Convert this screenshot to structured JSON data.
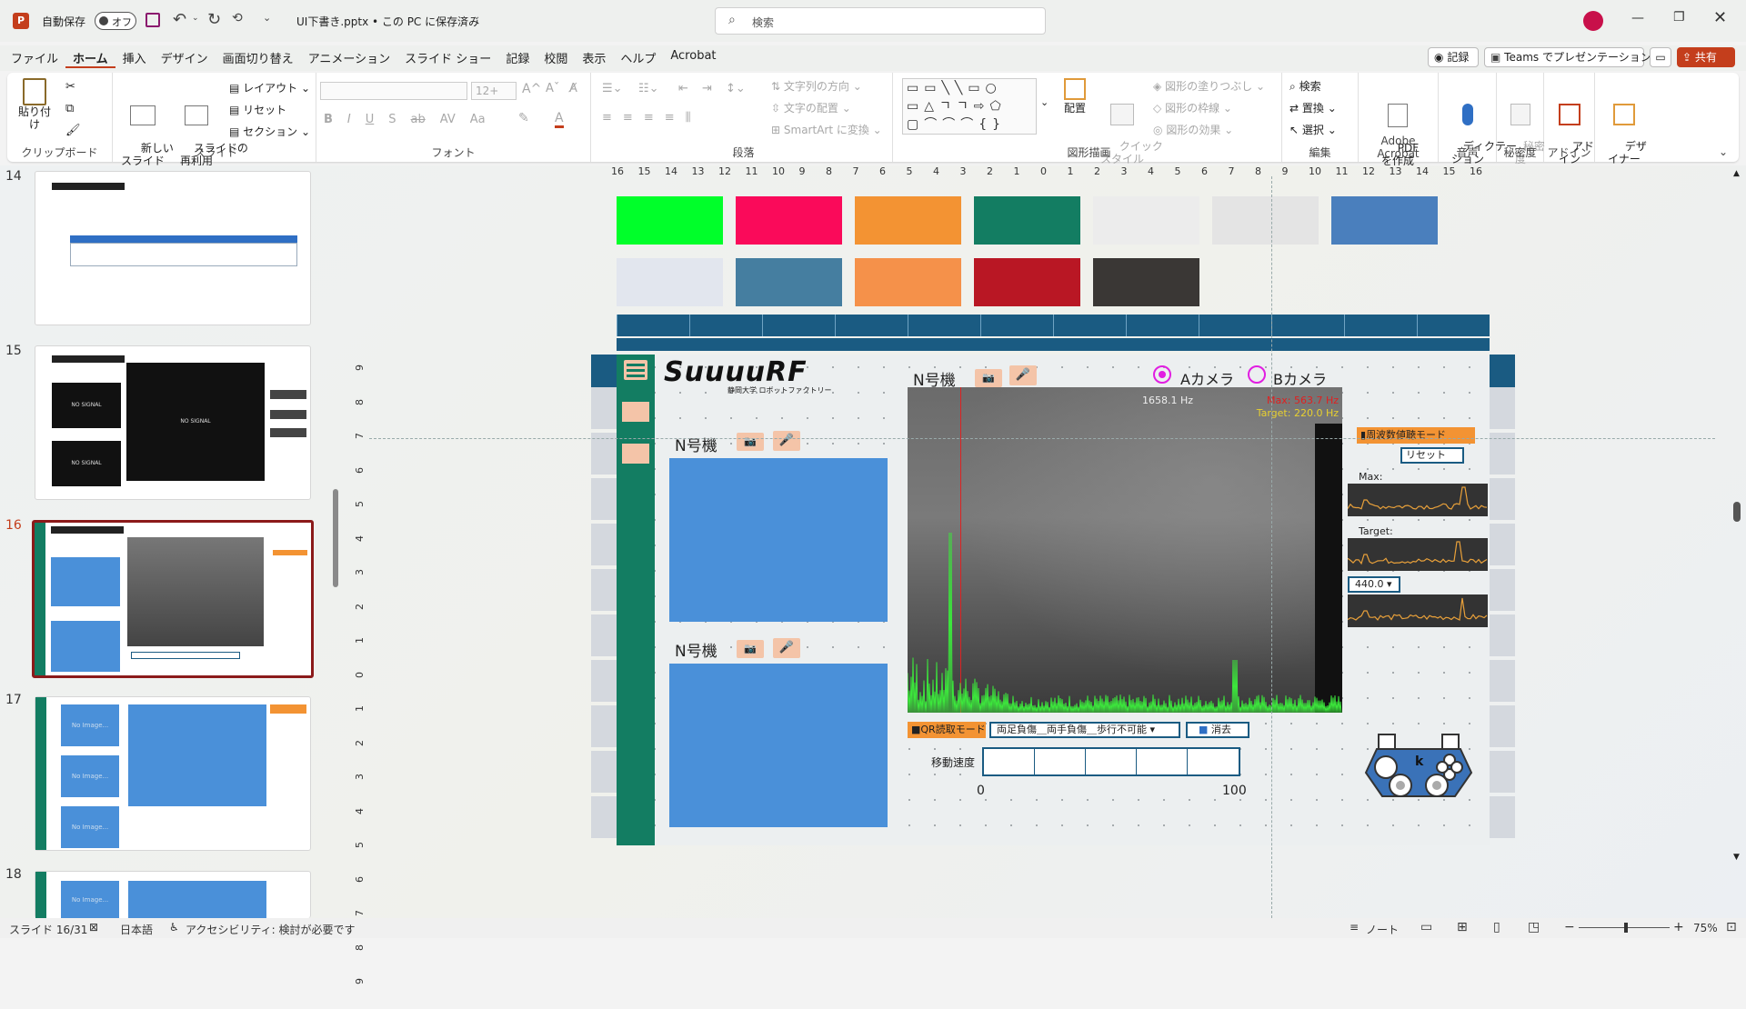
{
  "app": {
    "autosave_label": "自動保存",
    "autosave_state": "オフ",
    "file_title": "UI下書き.pptx • この PC に保存済み",
    "search_placeholder": "検索",
    "accent": "#c43e1c"
  },
  "menu": {
    "tabs": [
      "ファイル",
      "ホーム",
      "挿入",
      "デザイン",
      "画面切り替え",
      "アニメーション",
      "スライド ショー",
      "記録",
      "校閲",
      "表示",
      "ヘルプ",
      "Acrobat"
    ],
    "active": "ホーム",
    "record_label": "記録",
    "teams_label": "Teams でプレゼンテーション",
    "share_label": "共有"
  },
  "ribbon": {
    "clipboard": {
      "paste": "貼り付け",
      "label": "クリップボード"
    },
    "slides": {
      "new_slide": "新しい\nスライド",
      "reuse": "スライドの\n再利用",
      "layout": "レイアウト",
      "reset": "リセット",
      "section": "セクション",
      "label": "スライド"
    },
    "font": {
      "size": "12+",
      "label": "フォント",
      "buttons": [
        "B",
        "I",
        "U",
        "S",
        "ab",
        "AV",
        "Aa"
      ]
    },
    "paragraph": {
      "text_direction": "文字列の方向",
      "text_align": "文字の配置",
      "smartart": "SmartArt に変換",
      "label": "段落"
    },
    "drawing": {
      "arrange": "配置",
      "quick_style": "クイック\nスタイル",
      "fill": "図形の塗りつぶし",
      "outline": "図形の枠線",
      "effect": "図形の効果",
      "label": "図形描画"
    },
    "editing": {
      "find": "検索",
      "replace": "置換",
      "select": "選択",
      "label": "編集"
    },
    "acrobat": {
      "create_pdf": "PDF\nを作成",
      "label": "Adobe Acrobat"
    },
    "voice": {
      "dictate": "ディクテー\nション",
      "label": "音声"
    },
    "sensitivity": {
      "btn": "秘密\n度",
      "label": "秘密度"
    },
    "addins": {
      "btn": "アド\nイン",
      "label": "アドイン"
    },
    "designer": {
      "btn": "デザ\nイナー"
    }
  },
  "slides_panel": {
    "items": [
      {
        "num": "14"
      },
      {
        "num": "15"
      },
      {
        "num": "16",
        "selected": true
      },
      {
        "num": "17"
      },
      {
        "num": "18"
      }
    ],
    "no_signal": "NO SIGNAL",
    "no_image": "No Image..."
  },
  "ruler": {
    "top": [
      "16",
      "15",
      "14",
      "13",
      "12",
      "11",
      "10",
      "9",
      "8",
      "7",
      "6",
      "5",
      "4",
      "3",
      "2",
      "1",
      "0",
      "1",
      "2",
      "3",
      "4",
      "5",
      "6",
      "7",
      "8",
      "9",
      "10",
      "11",
      "12",
      "13",
      "14",
      "15",
      "16"
    ],
    "left": [
      "9",
      "8",
      "7",
      "6",
      "5",
      "4",
      "3",
      "2",
      "1",
      "0",
      "1",
      "2",
      "3",
      "4",
      "5",
      "6",
      "7",
      "8",
      "9"
    ]
  },
  "palette": {
    "row1": [
      "#00ff2a",
      "#fa0a5a",
      "#f39333",
      "#137d62",
      "#ececec",
      "#e4e4e4",
      "#4a7fbd"
    ],
    "row2": [
      "#e2e6ee",
      "#457ea0",
      "#f5914a",
      "#b91724",
      "#3a3735"
    ]
  },
  "slide": {
    "logo": "SuuuuRF",
    "logo_sub": "静岡大学 ロボットファクトリー",
    "machine_label_1": "N号機",
    "machine_label_2": "N号機",
    "machine_label_3": "N号機",
    "camera_a": "Aカメラ",
    "camera_b": "Bカメラ",
    "freq_readout": "1658.1 Hz",
    "max_readout": "Max: 563.7 Hz",
    "target_readout": "Target: 220.0 Hz",
    "freq_mode_btn": "周波数値聴モード",
    "reset_btn": "リセット",
    "max_label": "Max:",
    "target_label": "Target:",
    "select_value": "440.0 ▾",
    "qr_btn": "■QR読取モード",
    "mode_select": "両足負傷＿両手負傷＿歩行不可能 ▾",
    "erase_btn": "消去",
    "speed_label": "移動速度",
    "speed_min": "0",
    "speed_max": "100",
    "teal": "#137d62",
    "navy": "#1a5b82",
    "panel_blue": "#4a90d9",
    "spectrum_green": "#3ce63c"
  },
  "status": {
    "slide_pos": "スライド 16/31",
    "language": "日本語",
    "accessibility": "アクセシビリティ: 検討が必要です",
    "notes": "ノート",
    "zoom": "75%"
  }
}
